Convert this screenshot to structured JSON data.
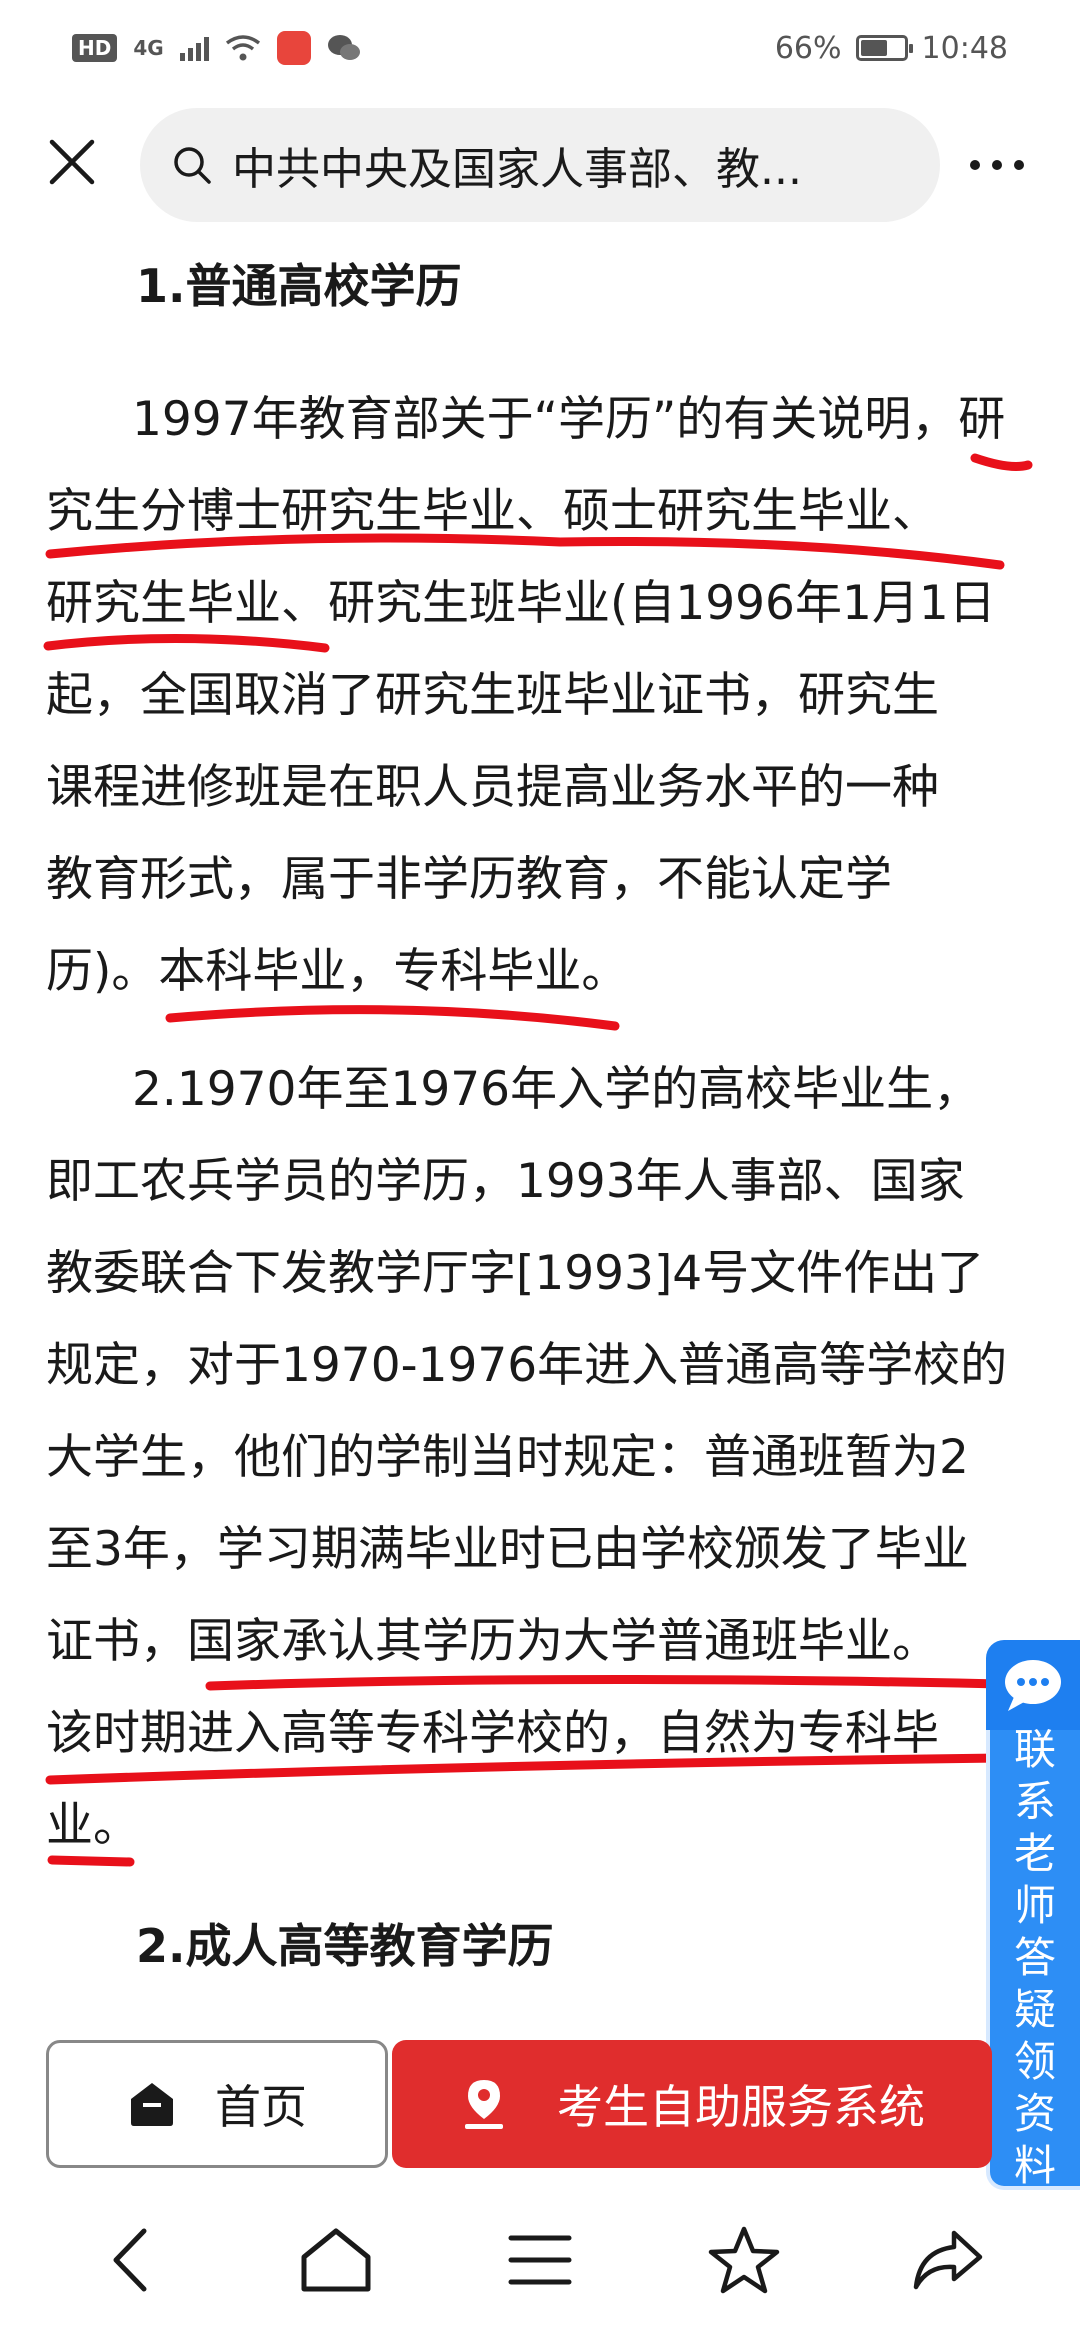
{
  "status_bar": {
    "badge": "HD",
    "network": "4G",
    "battery_text": "66%",
    "battery_level": 0.66,
    "time": "10:48"
  },
  "search": {
    "query": "中共中央及国家人事部、教..."
  },
  "article": {
    "section1_title": "1.普通高校学历",
    "lines": [
      "1997年教育部关于“学历”的有关说明，研",
      "究生分博士研究生毕业、硕士研究生毕业、",
      "研究生毕业、研究生班毕业(自1996年1月1日",
      "起，全国取消了研究生班毕业证书，研究生",
      "课程进修班是在职人员提高业务水平的一种",
      "教育形式，属于非学历教育，不能认定学",
      "历)。本科毕业，专科毕业。",
      "2.1970年至1976年入学的高校毕业生，",
      "即工农兵学员的学历，1993年人事部、国家",
      "教委联合下发教学厅字[1993]4号文件作出了",
      "规定，对于1970-1976年进入普通高等学校的",
      "大学生，他们的学制当时规定：普通班暂为2",
      "至3年，学习期满毕业时已由学校颁发了毕业",
      "证书，国家承认其学历为大学普通班毕业。",
      "该时期进入高等专科学校的，自然为专科毕",
      "业。"
    ],
    "section2_title": "2.成人高等教育学历"
  },
  "float": {
    "side_text": [
      "联",
      "系",
      "老",
      "师",
      "答",
      "疑",
      "领",
      "资",
      "料"
    ]
  },
  "actions": {
    "home_label": "首页",
    "service_label": "考生自助服务系统"
  },
  "colors": {
    "accent_red": "#e02d2d",
    "float_blue": "#2d8ef5",
    "underline_red": "#e8101a"
  }
}
